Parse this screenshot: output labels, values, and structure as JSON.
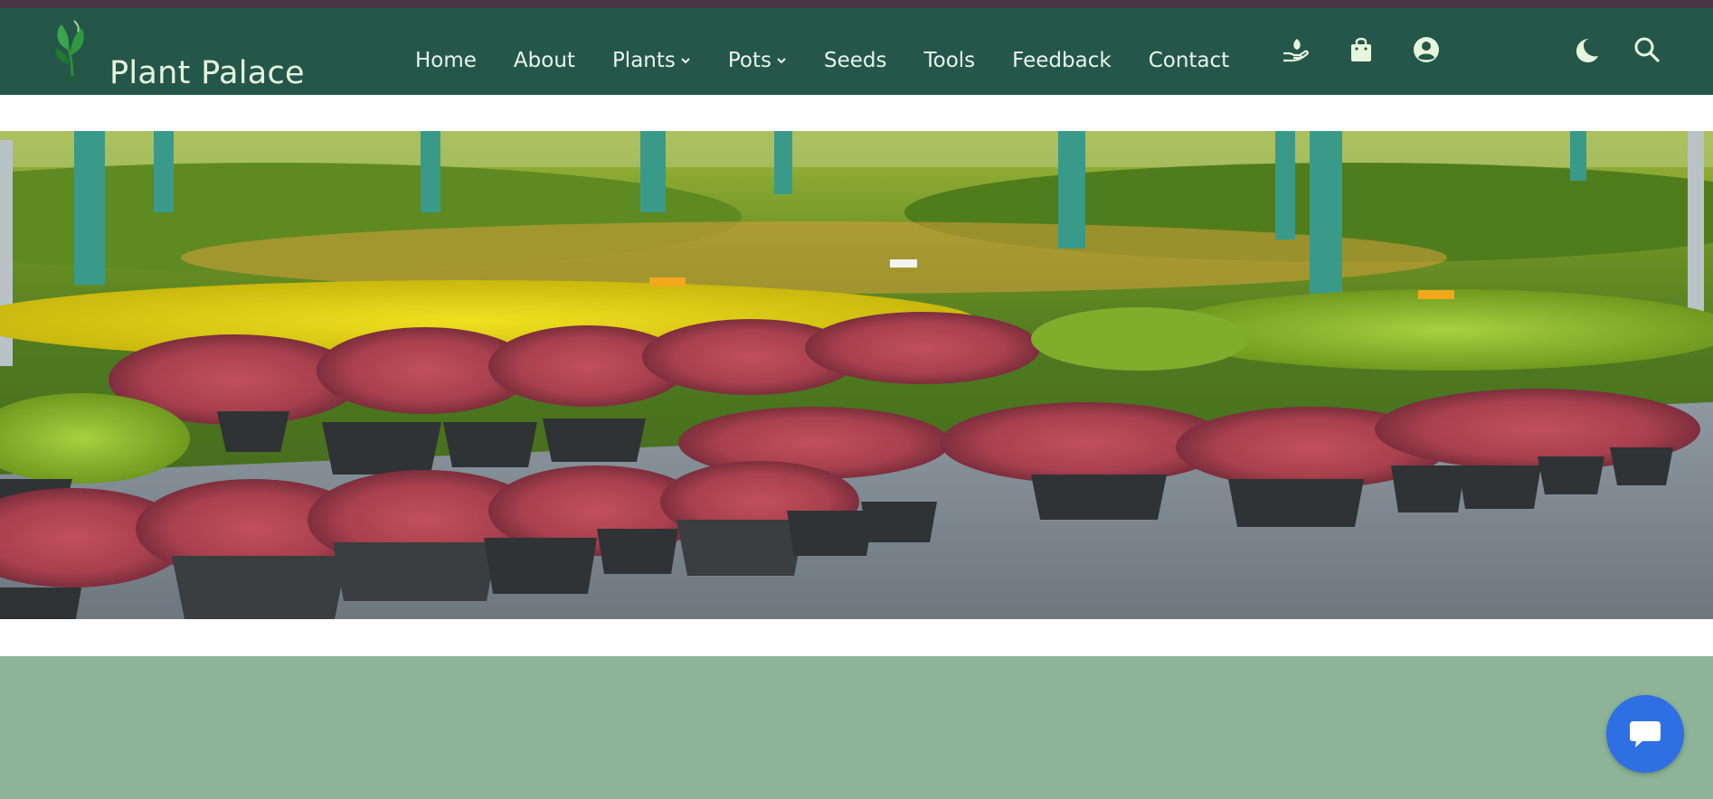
{
  "site": {
    "brand": "Plant Palace",
    "logo_icon": "sprout-logo-icon"
  },
  "nav": {
    "links": [
      {
        "label": "Home",
        "dropdown": false
      },
      {
        "label": "About",
        "dropdown": false
      },
      {
        "label": "Plants",
        "dropdown": true
      },
      {
        "label": "Pots",
        "dropdown": true
      },
      {
        "label": "Seeds",
        "dropdown": false
      },
      {
        "label": "Tools",
        "dropdown": false
      },
      {
        "label": "Feedback",
        "dropdown": false
      },
      {
        "label": "Contact",
        "dropdown": false
      }
    ],
    "icons": [
      "plant-in-hand-icon",
      "shopping-bag-icon",
      "user-circle-icon"
    ],
    "right_icons": [
      "moon-icon",
      "search-icon"
    ]
  },
  "hero": {
    "image": "nursery-potted-shrubs-photo"
  },
  "chat": {
    "icon": "chat-bubble-icon"
  },
  "colors": {
    "topbar": "#4a3448",
    "navbar": "#24574a",
    "brand_text": "#e6f6dc",
    "footer_band": "#8db498",
    "chat_button": "#2f6fe4"
  }
}
